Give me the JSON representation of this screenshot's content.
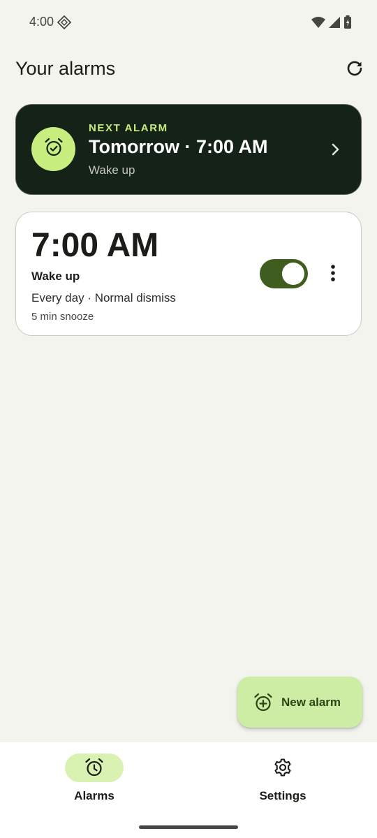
{
  "status_bar": {
    "time": "4:00",
    "icons": [
      "diamond-icon",
      "wifi-icon",
      "signal-icon",
      "battery-charging-icon"
    ]
  },
  "header": {
    "title": "Your alarms",
    "refresh_icon": "refresh-icon"
  },
  "next_alarm": {
    "eyebrow": "NEXT ALARM",
    "when": "Tomorrow · 7:00 AM",
    "label": "Wake up",
    "icon": "alarm-check-icon",
    "chevron_icon": "chevron-right-icon"
  },
  "alarms": [
    {
      "time": "7:00 AM",
      "name": "Wake up",
      "repeat": "Every day · Normal dismiss",
      "snooze": "5 min snooze",
      "enabled": true
    }
  ],
  "fab": {
    "label": "New alarm",
    "icon": "alarm-add-icon"
  },
  "bottom_nav": {
    "items": [
      {
        "label": "Alarms",
        "icon": "alarm-icon",
        "selected": true
      },
      {
        "label": "Settings",
        "icon": "gear-icon",
        "selected": false
      }
    ]
  },
  "colors": {
    "background": "#f4f4ef",
    "next_card_bg": "#152218",
    "accent_lime": "#c8ee7f",
    "toggle_on": "#3f5d1e",
    "fab_bg": "#cdeca4",
    "nav_pill": "#d9f2b2"
  }
}
